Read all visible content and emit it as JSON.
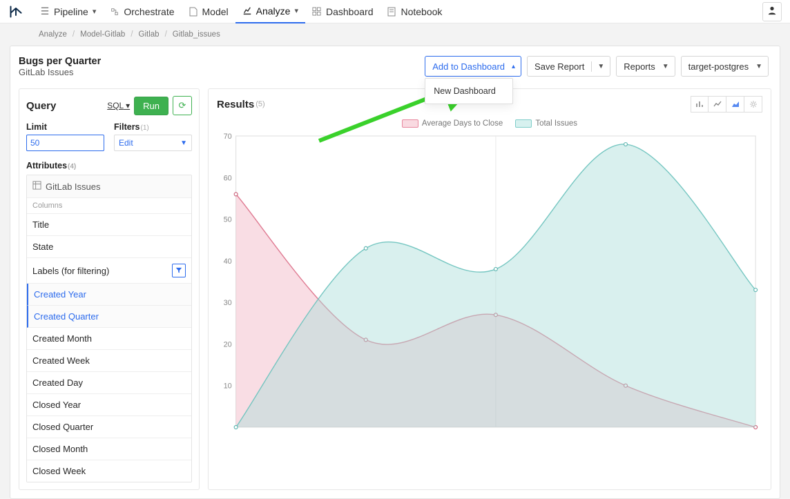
{
  "nav": {
    "items": [
      {
        "label": "Pipeline",
        "caret": true
      },
      {
        "label": "Orchestrate",
        "caret": false
      },
      {
        "label": "Model",
        "caret": false
      },
      {
        "label": "Analyze",
        "caret": true,
        "active": true
      },
      {
        "label": "Dashboard",
        "caret": false
      },
      {
        "label": "Notebook",
        "caret": false
      }
    ]
  },
  "breadcrumbs": [
    "Analyze",
    "Model-Gitlab",
    "Gitlab",
    "Gitlab_issues"
  ],
  "page": {
    "title": "Bugs per Quarter",
    "subtitle": "GitLab Issues"
  },
  "header_actions": {
    "add_dashboard": "Add to Dashboard",
    "add_dashboard_menu": [
      "New Dashboard"
    ],
    "save_report": "Save Report",
    "reports": "Reports",
    "target": "target-postgres"
  },
  "query": {
    "title": "Query",
    "sql_label": "SQL",
    "run_label": "Run",
    "limit": {
      "label": "Limit",
      "value": "50"
    },
    "filters": {
      "label": "Filters",
      "count": "(1)",
      "value": "Edit"
    },
    "attributes": {
      "label": "Attributes",
      "count": "(4)",
      "group": "GitLab Issues",
      "subhead": "Columns",
      "items": [
        {
          "label": "Title"
        },
        {
          "label": "State"
        },
        {
          "label": "Labels (for filtering)",
          "filter": true
        },
        {
          "label": "Created Year",
          "selected": true
        },
        {
          "label": "Created Quarter",
          "selected": true
        },
        {
          "label": "Created Month"
        },
        {
          "label": "Created Week"
        },
        {
          "label": "Created Day"
        },
        {
          "label": "Closed Year"
        },
        {
          "label": "Closed Quarter"
        },
        {
          "label": "Closed Month"
        },
        {
          "label": "Closed Week"
        }
      ]
    }
  },
  "results": {
    "title": "Results",
    "count": "(5)"
  },
  "chart_data": {
    "type": "area",
    "ylim": [
      0,
      70
    ],
    "yticks": [
      10,
      20,
      30,
      40,
      50,
      60,
      70
    ],
    "legend": [
      "Average Days to Close",
      "Total Issues"
    ],
    "x_indices": [
      0,
      1,
      2,
      3,
      4
    ],
    "series": [
      {
        "name": "Average Days to Close",
        "color": "pink",
        "values": [
          56,
          21,
          27,
          10,
          0
        ]
      },
      {
        "name": "Total Issues",
        "color": "teal",
        "values": [
          0,
          43,
          38,
          68,
          33
        ]
      }
    ]
  }
}
